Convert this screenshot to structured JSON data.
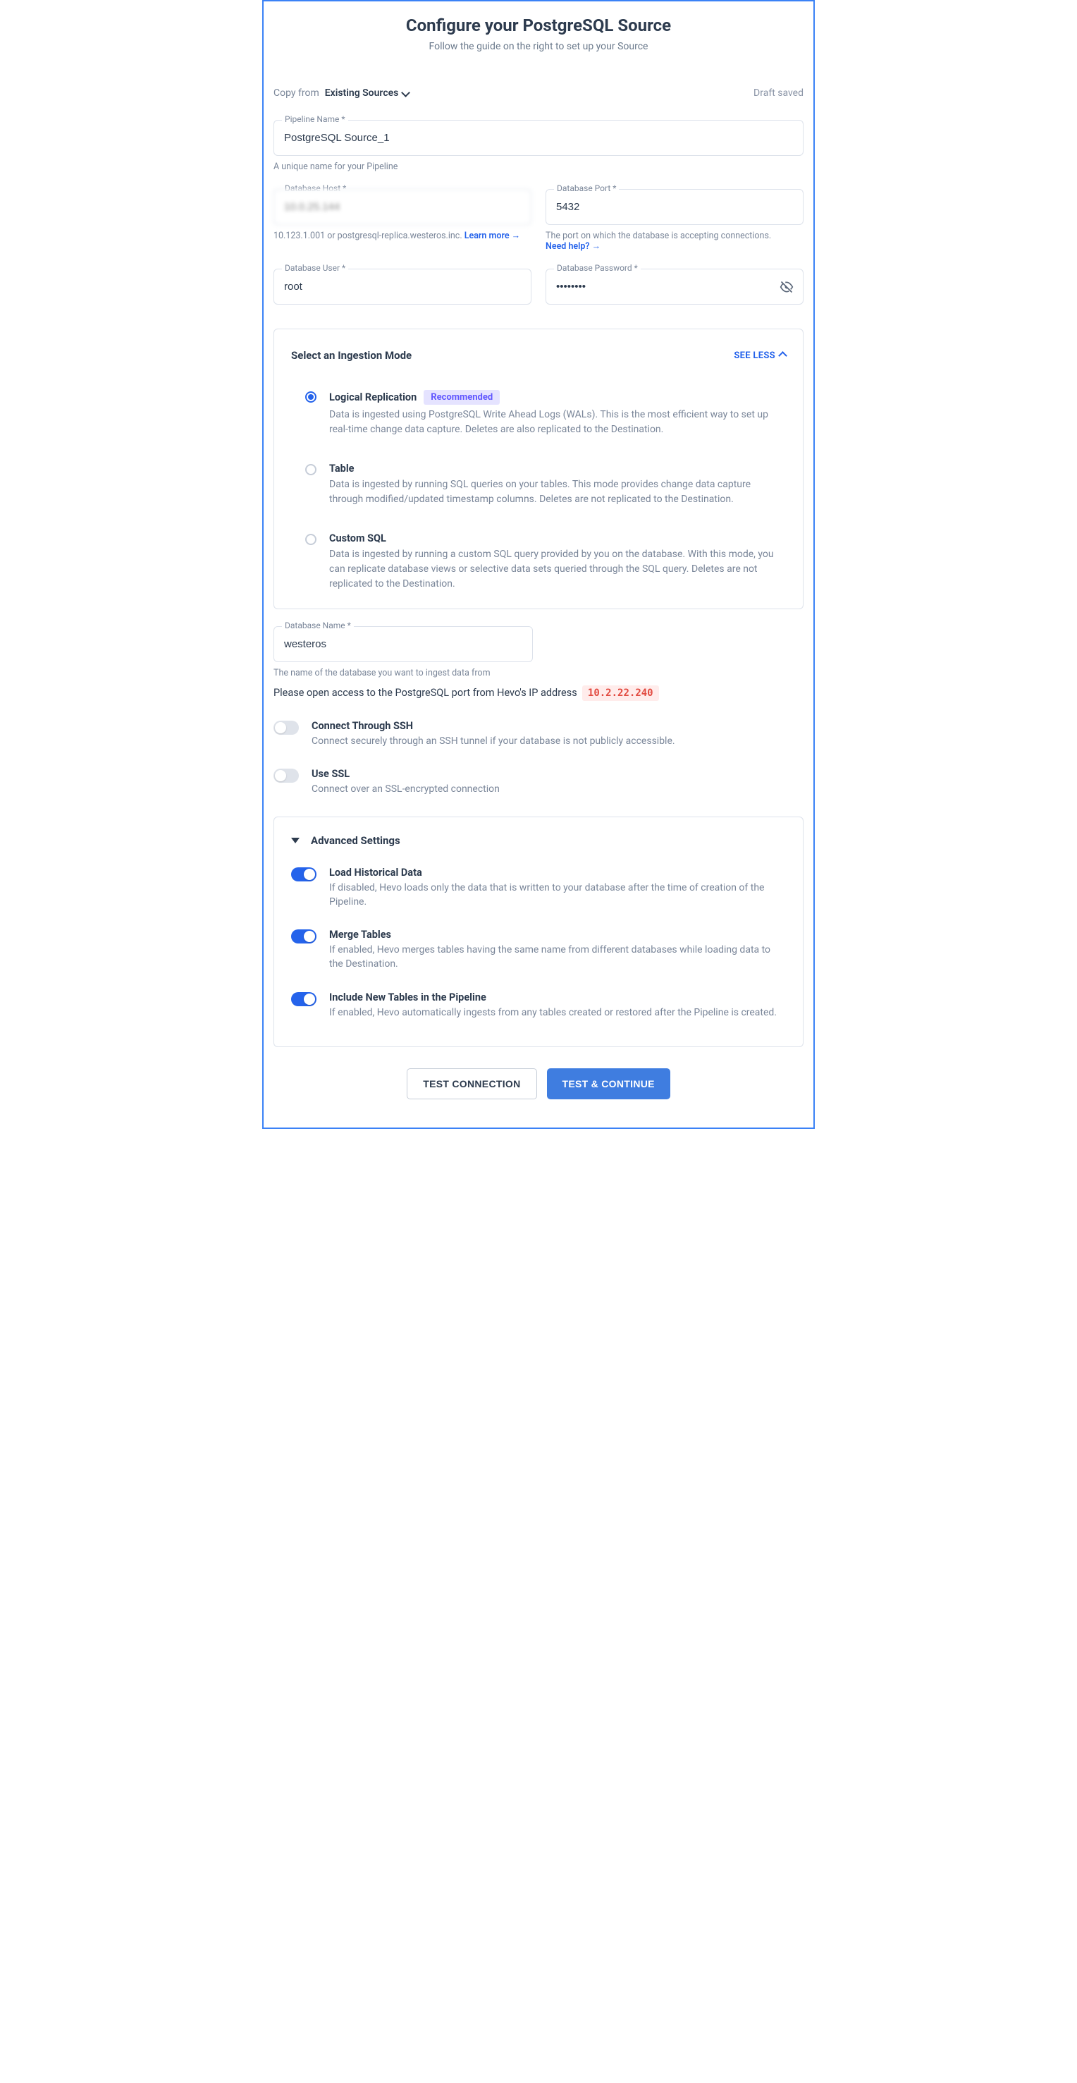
{
  "header": {
    "title": "Configure your PostgreSQL Source",
    "subtitle": "Follow the guide on the right to set up your Source"
  },
  "top": {
    "copy_label": "Copy from",
    "copy_value": "Existing Sources",
    "draft": "Draft saved"
  },
  "pipeline": {
    "label": "Pipeline Name *",
    "value": "PostgreSQL Source_1",
    "helper": "A unique name for your Pipeline"
  },
  "host": {
    "label": "Database Host *",
    "value": "10.0.25.144",
    "helper_prefix": "10.123.1.001 or postgresql-replica.westeros.inc. ",
    "helper_link": "Learn more"
  },
  "port": {
    "label": "Database Port *",
    "value": "5432",
    "helper_line1": "The port on which the database is accepting connections.",
    "helper_link": "Need help?"
  },
  "user": {
    "label": "Database User *",
    "value": "root"
  },
  "password": {
    "label": "Database Password *",
    "value": "••••••••"
  },
  "ingestion": {
    "title": "Select an Ingestion Mode",
    "toggle_label": "SEE LESS",
    "options": [
      {
        "title": "Logical Replication",
        "badge": "Recommended",
        "desc": "Data is ingested using PostgreSQL Write Ahead Logs (WALs). This is the most efficient way to set up real-time change data capture. Deletes are also replicated to the Destination.",
        "selected": true
      },
      {
        "title": "Table",
        "desc": "Data is ingested by running SQL queries on your tables. This mode provides change data capture through modified/updated timestamp columns. Deletes are not replicated to the Destination.",
        "selected": false
      },
      {
        "title": "Custom SQL",
        "desc": "Data is ingested by running a custom SQL query provided by you on the database. With this mode, you can replicate database views or selective data sets queried through the SQL query. Deletes are not replicated to the Destination.",
        "selected": false
      }
    ]
  },
  "dbname": {
    "label": "Database Name *",
    "value": "westeros",
    "helper": "The name of the database you want to ingest data from"
  },
  "ip_access": {
    "text": "Please open access to the PostgreSQL port from Hevo's IP address",
    "ip": "10.2.22.240"
  },
  "ssh": {
    "title": "Connect Through SSH",
    "desc": "Connect securely through an SSH tunnel if your database is not publicly accessible.",
    "on": false
  },
  "ssl": {
    "title": "Use SSL",
    "desc": "Connect over an SSL-encrypted connection",
    "on": false
  },
  "advanced": {
    "title": "Advanced Settings",
    "items": [
      {
        "title": "Load Historical Data",
        "desc": "If disabled, Hevo loads only the data that is written to your database after the time of creation of the Pipeline.",
        "on": true
      },
      {
        "title": "Merge Tables",
        "desc": "If enabled, Hevo merges tables having the same name from different databases while loading data to the Destination.",
        "on": true
      },
      {
        "title": "Include New Tables in the Pipeline",
        "desc": "If enabled, Hevo automatically ingests from any tables created or restored after the Pipeline is created.",
        "on": true
      }
    ]
  },
  "footer": {
    "test": "TEST CONNECTION",
    "continue": "TEST & CONTINUE"
  }
}
